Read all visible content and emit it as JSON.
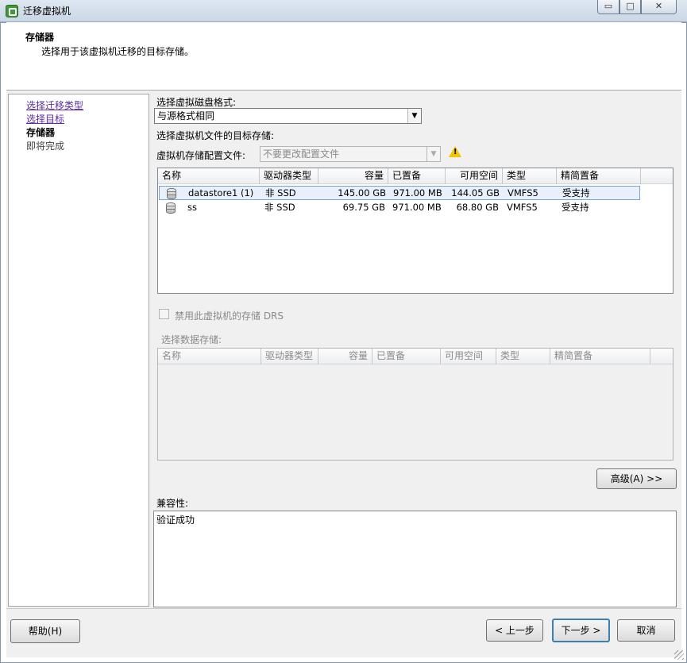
{
  "window": {
    "title": "迁移虚拟机",
    "min_symbol": "▭",
    "max_symbol": "□",
    "close_symbol": "✕"
  },
  "header": {
    "title": "存储器",
    "subtitle": "选择用于该虚拟机迁移的目标存储。"
  },
  "nav": {
    "items": [
      {
        "label": "选择迁移类型",
        "state": "link"
      },
      {
        "label": "选择目标",
        "state": "link"
      },
      {
        "label": "存储器",
        "state": "current"
      },
      {
        "label": "即将完成",
        "state": "pending"
      }
    ]
  },
  "disk_format": {
    "label": "选择虚拟磁盘格式:",
    "value": "与源格式相同"
  },
  "target_storage_label": "选择虚拟机文件的目标存储:",
  "storage_profile": {
    "label": "虚拟机存储配置文件:",
    "value": "不要更改配置文件"
  },
  "datastore_table": {
    "columns": [
      "名称",
      "驱动器类型",
      "容量",
      "已置备",
      "可用空间",
      "类型",
      "精简置备"
    ],
    "rows": [
      {
        "name": "datastore1 (1)",
        "drive": "非 SSD",
        "capacity": "145.00 GB",
        "provisioned": "971.00 MB",
        "free": "144.05 GB",
        "type": "VMFS5",
        "thin": "受支持",
        "selected": true
      },
      {
        "name": "ss",
        "drive": "非 SSD",
        "capacity": "69.75 GB",
        "provisioned": "971.00 MB",
        "free": "68.80 GB",
        "type": "VMFS5",
        "thin": "受支持",
        "selected": false
      }
    ]
  },
  "drs_checkbox": {
    "label": "禁用此虚拟机的存储 DRS",
    "checked": false,
    "enabled": false
  },
  "select_datastore_label": "选择数据存储:",
  "datastore_table2": {
    "columns": [
      "名称",
      "驱动器类型",
      "容量",
      "已置备",
      "可用空间",
      "类型",
      "精简置备"
    ]
  },
  "advanced_button": "高级(A) >>",
  "compatibility": {
    "label": "兼容性:",
    "value": "验证成功"
  },
  "footer": {
    "help": "帮助(H)",
    "back": "< 上一步",
    "next": "下一步 >",
    "cancel": "取消"
  }
}
